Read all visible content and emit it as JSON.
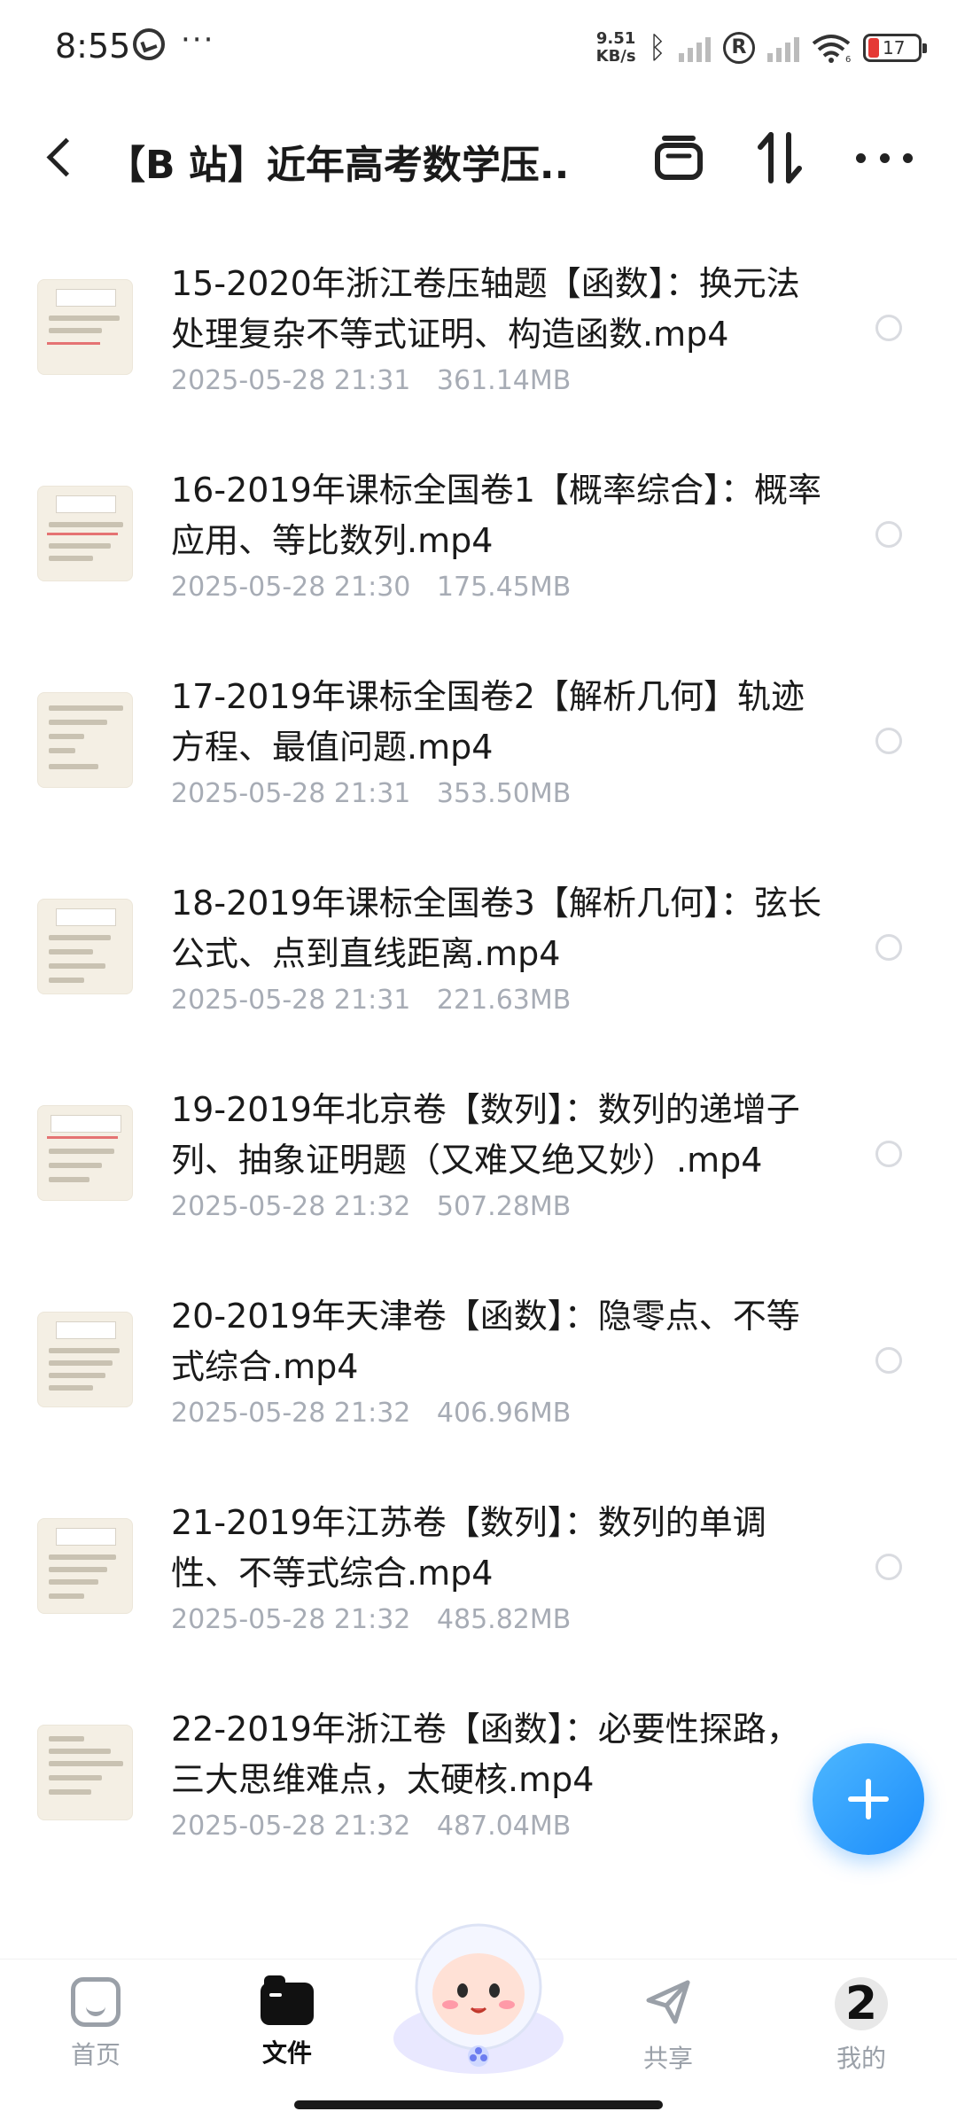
{
  "status_bar": {
    "time": "8:55",
    "net_speed_value": "9.51",
    "net_speed_unit": "KB/s",
    "signal2_label": "6",
    "battery_level": "17",
    "battery_color": "#e53935"
  },
  "header": {
    "title": "【B 站】近年高考数学压..."
  },
  "files": [
    {
      "name": "15-2020年浙江卷压轴题【函数】：换元法处理复杂不等式证明、构造函数.mp4",
      "date": "2025-05-28",
      "time": "21:31",
      "size": "361.14MB"
    },
    {
      "name": "16-2019年课标全国卷1【概率综合】：概率应用、等比数列.mp4",
      "date": "2025-05-28",
      "time": "21:30",
      "size": "175.45MB"
    },
    {
      "name": "17-2019年课标全国卷2【解析几何】轨迹方程、最值问题.mp4",
      "date": "2025-05-28",
      "time": "21:31",
      "size": "353.50MB"
    },
    {
      "name": "18-2019年课标全国卷3【解析几何】：弦长公式、点到直线距离.mp4",
      "date": "2025-05-28",
      "time": "21:31",
      "size": "221.63MB"
    },
    {
      "name": "19-2019年北京卷【数列】：数列的递增子列、抽象证明题（又难又绝又妙）.mp4",
      "date": "2025-05-28",
      "time": "21:32",
      "size": "507.28MB"
    },
    {
      "name": "20-2019年天津卷【函数】：隐零点、不等式综合.mp4",
      "date": "2025-05-28",
      "time": "21:32",
      "size": "406.96MB"
    },
    {
      "name": "21-2019年江苏卷【数列】：数列的单调性、不等式综合.mp4",
      "date": "2025-05-28",
      "time": "21:32",
      "size": "485.82MB"
    },
    {
      "name": "22-2019年浙江卷【函数】：必要性探路，三大思维难点，太硬核.mp4",
      "date": "2025-05-28",
      "time": "21:32",
      "size": "487.04MB"
    }
  ],
  "nav": {
    "home_label": "首页",
    "files_label": "文件",
    "share_label": "共享",
    "mine_label": "我的",
    "mine_badge": "2"
  },
  "colors": {
    "accent": "#1c8dfb",
    "meta_text": "#a7acb5"
  }
}
